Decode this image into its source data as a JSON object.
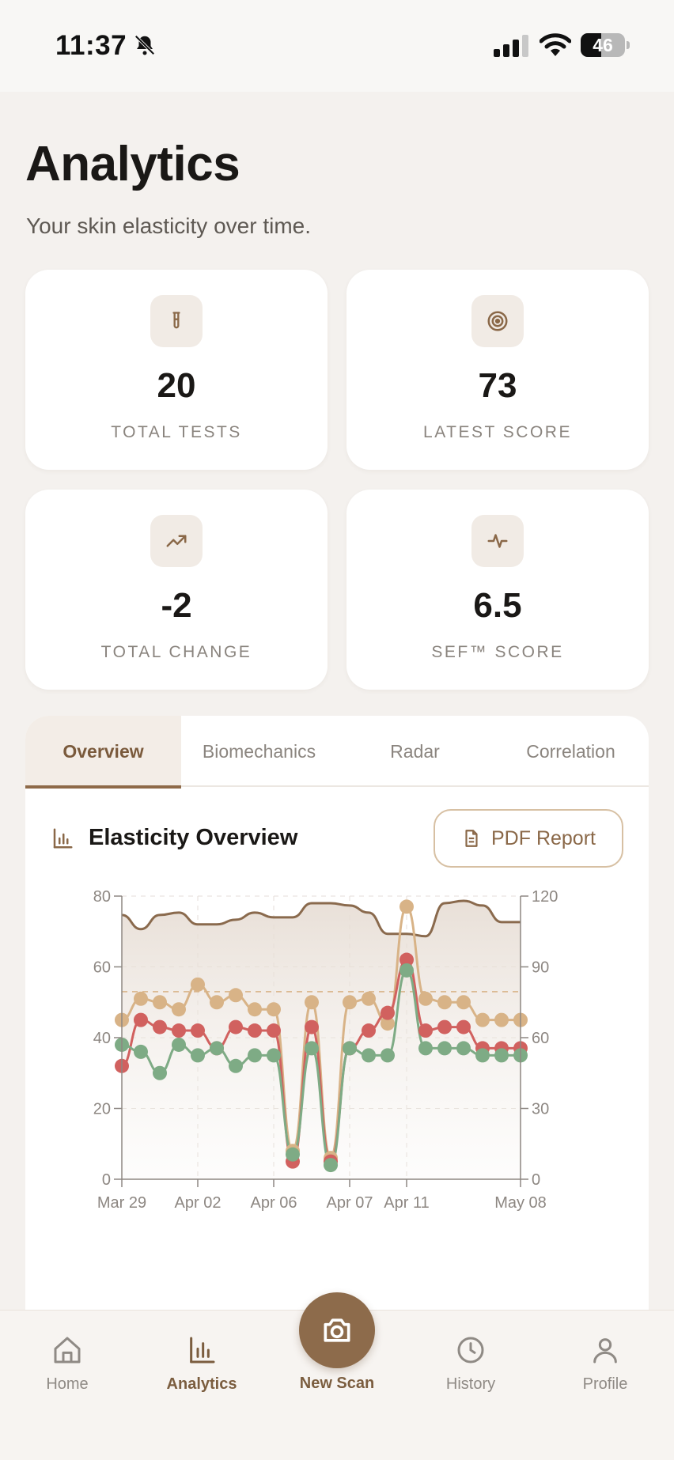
{
  "status": {
    "time": "11:37",
    "battery": "46",
    "battery_level": 0.46
  },
  "header": {
    "title": "Analytics",
    "subtitle": "Your skin elasticity over time."
  },
  "stats": [
    {
      "value": "20",
      "label": "TOTAL TESTS",
      "icon": "test-tube-icon"
    },
    {
      "value": "73",
      "label": "LATEST SCORE",
      "icon": "target-icon"
    },
    {
      "value": "-2",
      "label": "TOTAL CHANGE",
      "icon": "trending-up-icon"
    },
    {
      "value": "6.5",
      "label": "SEF™ SCORE",
      "icon": "activity-icon"
    }
  ],
  "tabs": [
    {
      "label": "Overview",
      "active": true
    },
    {
      "label": "Biomechanics",
      "active": false
    },
    {
      "label": "Radar",
      "active": false
    },
    {
      "label": "Correlation",
      "active": false
    }
  ],
  "chart": {
    "title": "Elasticity Overview",
    "pdf_label": "PDF Report"
  },
  "chart_data": {
    "type": "line",
    "x": [
      "Mar 29",
      "Mar 30",
      "Mar 31",
      "Apr 01",
      "Apr 02",
      "Apr 03",
      "Apr 04",
      "Apr 05",
      "Apr 06",
      "Apr 06b",
      "Apr 07a",
      "Apr 07b",
      "Apr 07c",
      "Apr 07",
      "Apr 08",
      "Apr 09",
      "Apr 10",
      "Apr 11",
      "Apr 12",
      "Apr 13",
      "Apr 14",
      "May 08"
    ],
    "x_tick_labels": [
      "Mar 29",
      "Apr 02",
      "Apr 06",
      "Apr 07",
      "Apr 11",
      "May 08"
    ],
    "ylim": [
      0,
      80
    ],
    "y_ticks": [
      0,
      20,
      40,
      60,
      80
    ],
    "y2lim": [
      0,
      120
    ],
    "y2_ticks": [
      0,
      30,
      60,
      90,
      120
    ],
    "grid": true,
    "series": [
      {
        "color": "#8a6a4d",
        "axis": "right",
        "style": "area",
        "values": [
          112,
          106,
          112,
          113,
          108,
          108,
          110,
          113,
          111,
          111,
          117,
          117,
          116,
          113,
          104,
          104,
          103,
          117,
          118,
          116,
          109,
          109
        ]
      },
      {
        "color": "#d8b387",
        "axis": "left",
        "values": [
          45,
          51,
          50,
          48,
          55,
          50,
          52,
          48,
          48,
          8,
          50,
          6,
          50,
          51,
          44,
          77,
          51,
          50,
          50,
          45,
          45,
          45
        ]
      },
      {
        "color": "#d1615f",
        "axis": "left",
        "values": [
          32,
          45,
          43,
          42,
          42,
          37,
          43,
          42,
          42,
          5,
          43,
          5,
          37,
          42,
          47,
          62,
          42,
          43,
          43,
          37,
          37,
          37
        ]
      },
      {
        "color": "#7eab85",
        "axis": "left",
        "values": [
          38,
          36,
          30,
          38,
          35,
          37,
          32,
          35,
          35,
          7,
          37,
          4,
          37,
          35,
          35,
          59,
          37,
          37,
          37,
          35,
          35,
          35
        ]
      }
    ],
    "reference_line": {
      "value": 53,
      "axis": "left"
    }
  },
  "nav": {
    "home": "Home",
    "analytics": "Analytics",
    "scan": "New Scan",
    "history": "History",
    "profile": "Profile"
  },
  "colors": {
    "accent": "#8d6b4b",
    "background": "#f4f1ee"
  }
}
